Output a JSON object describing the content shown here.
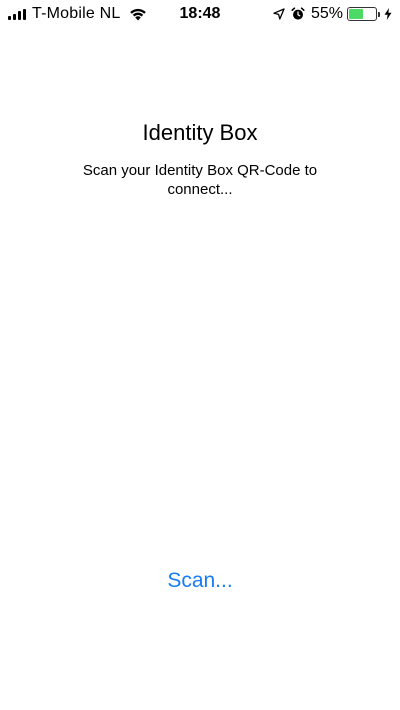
{
  "status_bar": {
    "carrier": "T-Mobile NL",
    "time": "18:48",
    "battery_percent": "55%",
    "battery_level": 0.55,
    "signal_bars": 4,
    "icons": [
      "signal-icon",
      "wifi-icon",
      "location-arrow-icon",
      "alarm-clock-icon",
      "battery-icon",
      "charging-bolt-icon"
    ]
  },
  "main": {
    "title": "Identity Box",
    "subtitle": "Scan your Identity Box QR-Code to connect...",
    "scan_button": "Scan..."
  },
  "colors": {
    "accent": "#1a7cf5",
    "battery": "#4cd964",
    "background": "#ffffff",
    "text": "#000000"
  }
}
